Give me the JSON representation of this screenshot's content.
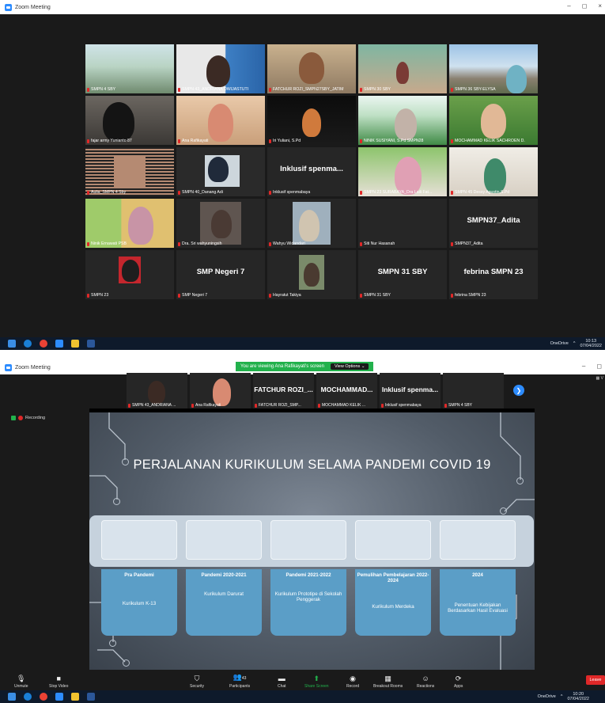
{
  "window": {
    "title": "Zoom Meeting",
    "controls": [
      "–",
      "◻",
      "×"
    ]
  },
  "gallery": {
    "tiles": [
      {
        "label": "SMPN 4 SBY",
        "big": "",
        "kind": "classroom"
      },
      {
        "label": "SMPN 43_ANDRIANA DWIJASTUTI",
        "big": "",
        "kind": "person-blue"
      },
      {
        "label": "FATCHUR ROZI_SMPN27SBY_JATIM",
        "big": "",
        "kind": "person-room"
      },
      {
        "label": "SMPN 30 SBY",
        "big": "",
        "kind": "room-green"
      },
      {
        "label": "SMPN 36 SBY-ELYSA",
        "big": "",
        "kind": "temple"
      },
      {
        "label": "fajar army Yunianto 87",
        "big": "",
        "kind": "dark-person"
      },
      {
        "label": "Ana Rafikayati",
        "big": "",
        "kind": "person-warm"
      },
      {
        "label": "Iri Yuliani, S.Pd",
        "big": "",
        "kind": "person-dark"
      },
      {
        "label": "NINIK SUSIYANI, S.Pd SMPN28",
        "big": "",
        "kind": "garden"
      },
      {
        "label": "MOCHAMMAD KELIK SACHROEN D.",
        "big": "",
        "kind": "garden-man",
        "active": true
      },
      {
        "label": "Aulia_SMPN 4 Sby",
        "big": "",
        "kind": "pattern"
      },
      {
        "label": "SMPN 40_Danang Adi",
        "big": "",
        "kind": "man-room"
      },
      {
        "label": "Inklusif spenmabaya",
        "big": "Inklusif spenma...",
        "kind": "name"
      },
      {
        "label": "SMPN 23 SURABAYA_Dra Laili Fat...",
        "big": "",
        "kind": "pink-hijab"
      },
      {
        "label": "SMPN 45 Dessy Agustin,S.Pd",
        "big": "",
        "kind": "green-hijab"
      },
      {
        "label": "Ninik Ernawati PSB",
        "big": "",
        "kind": "two-women"
      },
      {
        "label": "Dra. Sri wahyuningsih",
        "big": "",
        "kind": "dark-room"
      },
      {
        "label": "Wahyu Widandari",
        "big": "",
        "kind": "window-woman"
      },
      {
        "label": "Siti Nur Hasanah",
        "big": "",
        "kind": "blank"
      },
      {
        "label": "SMPN37_Adita",
        "big": "SMPN37_Adita",
        "kind": "name"
      },
      {
        "label": "SMPN 23",
        "big": "",
        "kind": "red-avatar"
      },
      {
        "label": "SMP Negeri 7",
        "big": "SMP Negeri 7",
        "kind": "name"
      },
      {
        "label": "Hayratut Takiya",
        "big": "",
        "kind": "small-woman"
      },
      {
        "label": "SMPN 31 SBY",
        "big": "SMPN 31 SBY",
        "kind": "name"
      },
      {
        "label": "febrina SMPN 23",
        "big": "febrina SMPN 23",
        "kind": "name"
      }
    ]
  },
  "taskbar": {
    "onedrive": "OneDrive",
    "time1": "10:13",
    "date1": "07/04/2022",
    "time2": "10:20",
    "date2": "07/04/2022"
  },
  "share": {
    "banner": "You are viewing Ana Rafikayati's screen",
    "view_options": "View Options ⌄",
    "view_right": "V",
    "recording": "Recording",
    "strip": [
      {
        "label": "SMPN 43_ANDRIANA ...",
        "big": "",
        "kind": "person-blue"
      },
      {
        "label": "Ana Rafikayati",
        "big": "",
        "kind": "person-warm"
      },
      {
        "label": "FATCHUR ROZI_SMP...",
        "big": "FATCHUR ROZI_...",
        "kind": "name"
      },
      {
        "label": "MOCHAMMAD KELIK ...",
        "big": "MOCHAMMAD...",
        "kind": "name"
      },
      {
        "label": "Inklusif spenmabaya",
        "big": "Inklusif spenma...",
        "kind": "name"
      },
      {
        "label": "SMPN 4 SBY",
        "big": "",
        "kind": "classroom"
      }
    ]
  },
  "slide": {
    "title": "PERJALANAN KURIKULUM SELAMA PANDEMI COVID 19",
    "cards": [
      {
        "heading": "Pra Pandemi",
        "body": "Kurikulum K-13"
      },
      {
        "heading": "Pandemi 2020-2021",
        "body": "Kurikulum Darurat"
      },
      {
        "heading": "Pandemi 2021-2022",
        "body": "Kurikulum Prototipe di Sekolah Penggerak"
      },
      {
        "heading": "Pemulihan Pembelajaran 2022-2024",
        "body": "Kurikulum Merdeka"
      },
      {
        "heading": "2024",
        "body": "Penentuan Kebijakan Berdasarkan Hasil Evaluasi"
      }
    ]
  },
  "controls": {
    "unmute": "Unmute",
    "stop_video": "Stop Video",
    "security": "Security",
    "participants": "Participants",
    "participants_count": "43",
    "chat": "Chat",
    "share_screen": "Share Screen",
    "record": "Record",
    "breakout": "Breakout Rooms",
    "reactions": "Reactions",
    "apps": "Apps",
    "leave": "Leave"
  }
}
